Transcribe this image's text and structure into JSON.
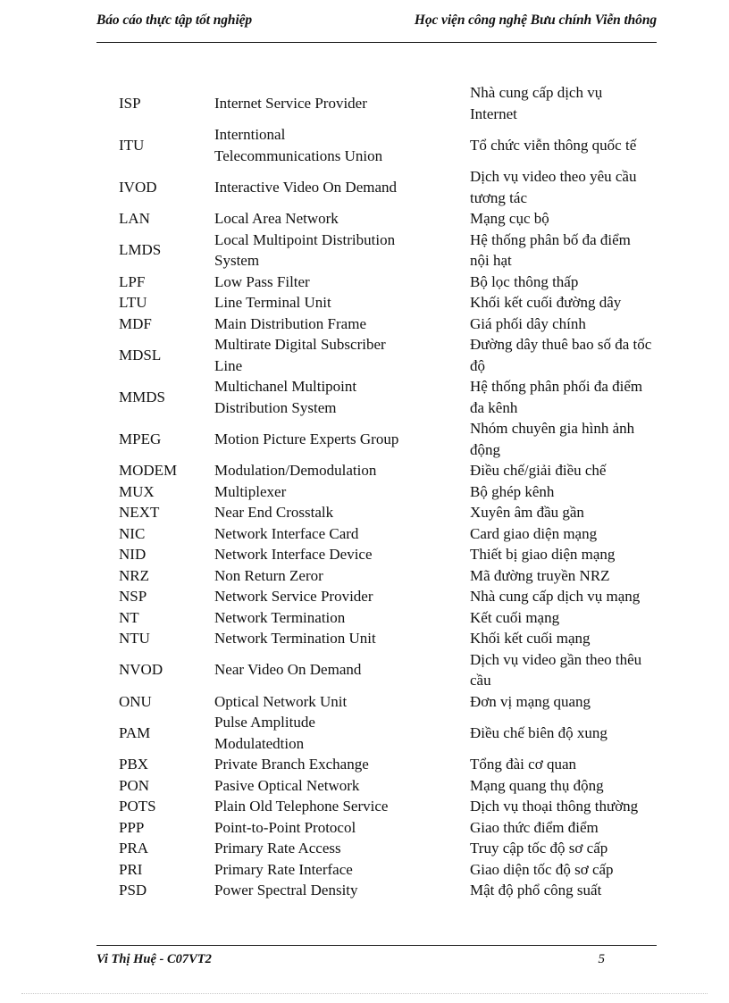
{
  "header": {
    "left": "Báo cáo thực tập tốt nghiệp",
    "right": "Học viện công nghệ Bưu chính Viễn thông"
  },
  "footer": {
    "author": "Vi Thị Huệ - C07VT2",
    "page_number": "5"
  },
  "glossary": {
    "rows": [
      {
        "abbr": "ISP",
        "full": [
          "Internet  Service Provider"
        ],
        "viet": [
          "Nhà cung cấp dịch vụ",
          "Internet"
        ]
      },
      {
        "abbr": "ITU",
        "full": [
          "Interntional",
          "Telecommunications  Union"
        ],
        "viet": [
          "Tổ chức viễn thông quốc tế"
        ]
      },
      {
        "abbr": "IVOD",
        "full": [
          "Interactive  Video  On Demand"
        ],
        "viet": [
          "Dịch vụ video theo yêu cầu",
          "tương tác"
        ]
      },
      {
        "abbr": "LAN",
        "full": [
          "Local Area Network"
        ],
        "viet": [
          "Mạng cục bộ"
        ]
      },
      {
        "abbr": "LMDS",
        "full": [
          "Local Multipoint  Distribution",
          "System"
        ],
        "viet": [
          "Hệ thống phân bố đa điểm",
          "nội hạt"
        ]
      },
      {
        "abbr": "LPF",
        "full": [
          "Low Pass Filter"
        ],
        "viet": [
          "Bộ lọc thông thấp"
        ]
      },
      {
        "abbr": "LTU",
        "full": [
          "Line  Terminal  Unit"
        ],
        "viet": [
          "Khối kết cuối đường dây"
        ]
      },
      {
        "abbr": "MDF",
        "full": [
          "Main  Distribution  Frame"
        ],
        "viet": [
          "Giá phối dây chính"
        ]
      },
      {
        "abbr": "MDSL",
        "full": [
          "Multirate  Digital  Subscriber",
          "Line"
        ],
        "viet": [
          "Đường dây thuê bao số đa tốc",
          "độ"
        ]
      },
      {
        "abbr": "MMDS",
        "full": [
          "Multichanel  Multipoint",
          "Distribution  System"
        ],
        "viet": [
          "Hệ thống phân phối đa điểm",
          "đa kênh"
        ]
      },
      {
        "abbr": "MPEG",
        "full": [
          "Motion Picture Experts Group"
        ],
        "viet": [
          "Nhóm chuyên gia hình ảnh",
          "động"
        ]
      },
      {
        "abbr": "MODEM",
        "full": [
          "Modulation/Demodulation"
        ],
        "viet": [
          "Điều chế/giải  điều chế"
        ]
      },
      {
        "abbr": "MUX",
        "full": [
          "Multiplexer"
        ],
        "viet": [
          "Bộ ghép kênh"
        ]
      },
      {
        "abbr": "NEXT",
        "full": [
          "Near End Crosstalk"
        ],
        "viet": [
          "Xuyên âm đầu gần"
        ]
      },
      {
        "abbr": "NIC",
        "full": [
          "Network Interface Card"
        ],
        "viet": [
          "Card giao diện mạng"
        ]
      },
      {
        "abbr": "NID",
        "full": [
          "Network Interface Device"
        ],
        "viet": [
          "Thiết bị giao diện mạng"
        ]
      },
      {
        "abbr": "NRZ",
        "full": [
          "Non Return Zeror"
        ],
        "viet": [
          "Mã đường truyền NRZ"
        ]
      },
      {
        "abbr": "NSP",
        "full": [
          "Network Service Provider"
        ],
        "viet": [
          "Nhà cung cấp dịch vụ mạng"
        ]
      },
      {
        "abbr": "NT",
        "full": [
          "Network Termination"
        ],
        "viet": [
          "Kết cuối mạng"
        ]
      },
      {
        "abbr": "NTU",
        "full": [
          "Network Termination  Unit"
        ],
        "viet": [
          "Khối kết cuối mạng"
        ]
      },
      {
        "abbr": "NVOD",
        "full": [
          "Near Video On Demand"
        ],
        "viet": [
          "Dịch vụ video gần theo thêu",
          "cầu"
        ]
      },
      {
        "abbr": "ONU",
        "full": [
          "Optical Network Unit"
        ],
        "viet": [
          "Đơn vị mạng quang"
        ]
      },
      {
        "abbr": "PAM",
        "full": [
          "Pulse Amplitude",
          "Modulatedtion"
        ],
        "viet": [
          "Điều chế biên độ xung"
        ]
      },
      {
        "abbr": "PBX",
        "full": [
          "Private Branch Exchange"
        ],
        "viet": [
          "Tổng đài cơ quan"
        ]
      },
      {
        "abbr": "PON",
        "full": [
          "Pasive Optical Network"
        ],
        "viet": [
          "Mạng quang thụ động"
        ]
      },
      {
        "abbr": "POTS",
        "full": [
          "Plain  Old Telephone Service"
        ],
        "viet": [
          "Dịch vụ thoại thông thường"
        ]
      },
      {
        "abbr": "PPP",
        "full": [
          "Point-to-Point Protocol"
        ],
        "viet": [
          "Giao thức điểm điểm"
        ]
      },
      {
        "abbr": "PRA",
        "full": [
          "Primary  Rate Access"
        ],
        "viet": [
          "Truy cập tốc độ sơ cấp"
        ]
      },
      {
        "abbr": "PRI",
        "full": [
          "Primary  Rate Interface"
        ],
        "viet": [
          "Giao diện tốc độ sơ cấp"
        ]
      },
      {
        "abbr": "PSD",
        "full": [
          "Power Spectral Density"
        ],
        "viet": [
          "Mật độ phổ công suất"
        ]
      }
    ]
  }
}
